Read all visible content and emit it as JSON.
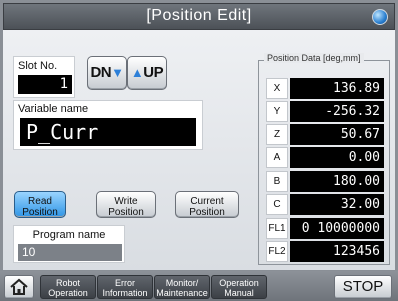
{
  "title": "[Position Edit]",
  "slot": {
    "label": "Slot No.",
    "value": "1"
  },
  "buttons": {
    "dn": "DN",
    "up": "UP",
    "read": [
      "Read",
      "Position"
    ],
    "write": [
      "Write",
      "Position"
    ],
    "current": [
      "Current",
      "Position"
    ]
  },
  "variable": {
    "label": "Variable name",
    "value": "P_Curr"
  },
  "program": {
    "label": "Program name",
    "value": "10"
  },
  "position": {
    "title": "Position Data [deg,mm]",
    "rows": [
      {
        "axis": "X",
        "value": "136.89"
      },
      {
        "axis": "Y",
        "value": "-256.32"
      },
      {
        "axis": "Z",
        "value": "50.67"
      },
      {
        "axis": "A",
        "value": "0.00"
      },
      {
        "axis": "B",
        "value": "180.00"
      },
      {
        "axis": "C",
        "value": "32.00"
      },
      {
        "axis": "FL1",
        "value": "0 10000000"
      },
      {
        "axis": "FL2",
        "value": "123456"
      }
    ]
  },
  "nav": [
    [
      "Robot",
      "Operation"
    ],
    [
      "Error",
      "Information"
    ],
    [
      "Monitor/",
      "Maintenance"
    ],
    [
      "Operation",
      "Manual"
    ]
  ],
  "stop": "STOP",
  "colors": {
    "accent": "#2f95e6",
    "display_bg": "#000000"
  },
  "icons": {
    "home": "home-icon",
    "globe": "globe-icon"
  }
}
